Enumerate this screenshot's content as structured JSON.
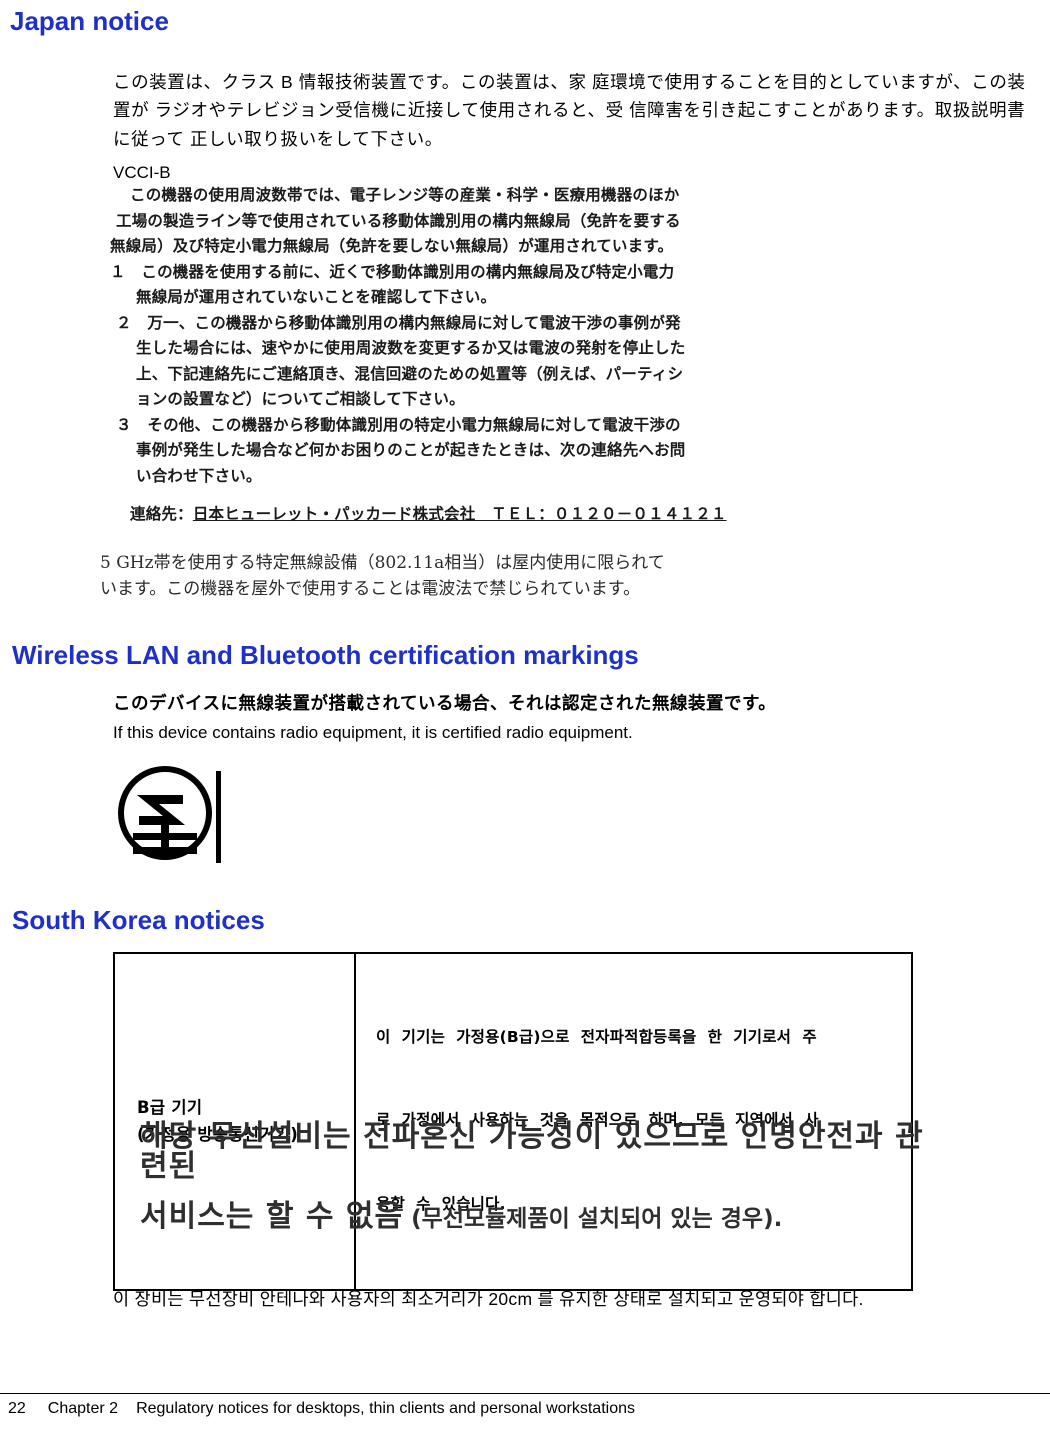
{
  "page": {
    "number": "22",
    "chapter_label": "Chapter 2",
    "chapter_title": "Regulatory notices for desktops, thin clients and personal workstations",
    "heading_color": "#1f30c8"
  },
  "japan": {
    "heading": "Japan notice",
    "paragraph": "この装置は、クラス B 情報技術装置です。この装置は、家 庭環境で使用することを目的としていますが、この装置が ラジオやテレビジョン受信機に近接して使用されると、受 信障害を引き起こすことがあります。取扱説明書に従って 正しい取り扱いをして下さい。",
    "vcci": "VCCI-B",
    "notice_lines": [
      "この機器の使用周波数帯では、電子レンジ等の産業・科学・医療用機器のほか",
      "工場の製造ライン等で使用されている移動体識別用の構内無線局（免許を要する",
      "無線局）及び特定小電力無線局（免許を要しない無線局）が運用されています。",
      "１　この機器を使用する前に、近くで移動体識別用の構内無線局及び特定小電力",
      "無線局が運用されていないことを確認して下さい。",
      "２　万一、この機器から移動体識別用の構内無線局に対して電波干渉の事例が発",
      "生した場合には、速やかに使用周波数を変更するか又は電波の発射を停止した",
      "上、下記連絡先にご連絡頂き、混信回避のための処置等（例えば、パーティシ",
      "ョンの設置など）についてご相談して下さい。",
      "３　その他、この機器から移動体識別用の特定小電力無線局に対して電波干渉の",
      "事例が発生した場合など何かお困りのことが起きたときは、次の連絡先へお問",
      "い合わせ下さい。"
    ],
    "contact_label": "連絡先：",
    "contact_value": "日本ヒューレット・パッカード株式会社　ＴＥＬ：０１２０－０１４１２１",
    "ghz_note_line1": "5 GHz帯を使用する特定無線設備（802.11a相当）は屋内使用に限られて",
    "ghz_note_line2": "います。この機器を屋外で使用することは電波法で禁じられています。"
  },
  "wireless": {
    "heading": "Wireless LAN and Bluetooth certification markings",
    "japanese_text": "このデバイスに無線装置が搭載されている場合、それは認定された無線装置です。",
    "english_text": "If this device contains radio equipment, it is certified radio equipment.",
    "mark_name": "telec-certification-mark"
  },
  "korea": {
    "heading": "South Korea notices",
    "table": {
      "left_line1": "B급 기기",
      "left_line2": "(가정용 방송통신기기)",
      "right_line1": "이  기기는  가정용(B급)으로  전자파적합등록을  한  기기로서  주",
      "right_line2": "로  가정에서  사용하는  것을  목적으로  하며,  모든  지역에서  사",
      "right_line3": "용할  수  있습니다."
    },
    "scan_line1": "해당 무선설비는 전파혼신 가능성이 있으므로 인명안전과 관련된",
    "scan_line2_main": "서비스는 할 수 없음",
    "scan_line2_suffix": " (무선모듈제품이 설치되어 있는 경우).",
    "final_note": "이 장비는 무선장비 안테나와 사용자의 최소거리가 20cm 를 유지한 상태로 설치되고 운영되야 합니다."
  }
}
